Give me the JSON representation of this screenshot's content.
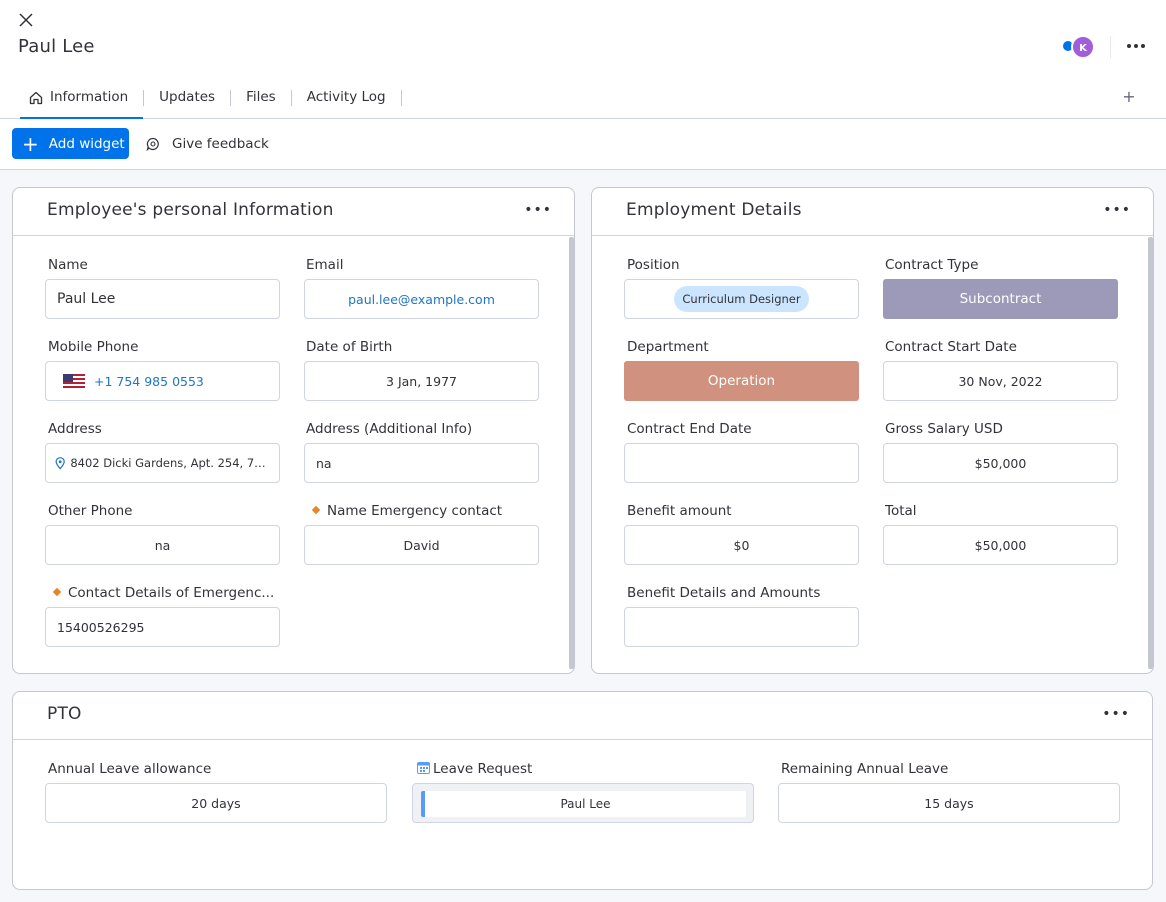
{
  "header": {
    "title": "Paul Lee",
    "avatar_initial": "K",
    "tabs": [
      "Information",
      "Updates",
      "Files",
      "Activity Log"
    ],
    "tab_add": "+"
  },
  "toolbar": {
    "add_widget": "Add widget",
    "feedback": "Give feedback"
  },
  "personal": {
    "title": "Employee's personal Information",
    "name_label": "Name",
    "name_value": "Paul Lee",
    "email_label": "Email",
    "email_value": "paul.lee@example.com",
    "mobile_label": "Mobile Phone",
    "mobile_value": "+1 754 985 0553",
    "dob_label": "Date of Birth",
    "dob_value": "3 Jan, 1977",
    "address_label": "Address",
    "address_value": "8402 Dicki Gardens, Apt. 254, 753...",
    "address_extra_label": "Address (Additional Info)",
    "address_extra_value": "na",
    "other_phone_label": "Other Phone",
    "other_phone_value": "na",
    "emergency_name_label": "Name Emergency contact",
    "emergency_name_value": "David",
    "emergency_contact_label": "Contact Details of Emergenc...",
    "emergency_contact_value": "15400526295"
  },
  "employment": {
    "title": "Employment Details",
    "position_label": "Position",
    "position_value": "Curriculum Designer",
    "contract_type_label": "Contract Type",
    "contract_type_value": "Subcontract",
    "department_label": "Department",
    "department_value": "Operation",
    "start_label": "Contract Start Date",
    "start_value": "30 Nov, 2022",
    "end_label": "Contract End Date",
    "end_value": "",
    "salary_label": "Gross Salary USD",
    "salary_value": "$50,000",
    "benefit_label": "Benefit amount",
    "benefit_value": "$0",
    "total_label": "Total",
    "total_value": "$50,000",
    "benefit_details_label": "Benefit Details and Amounts",
    "benefit_details_value": ""
  },
  "pto": {
    "title": "PTO",
    "allowance_label": "Annual Leave allowance",
    "allowance_value": "20 days",
    "request_label": "Leave Request",
    "request_value": "Paul Lee",
    "remaining_label": "Remaining Annual Leave",
    "remaining_value": "15 days"
  },
  "colors": {
    "primary": "#0073ea",
    "subcontract": "#9d99b9",
    "operation": "#d0917f",
    "chip": "#cce5ff",
    "avatar": "#a25ddc"
  },
  "icons": [
    "close-icon",
    "home-icon",
    "plus-icon",
    "feedback-icon",
    "more-icon",
    "flag-us-icon",
    "location-pin-icon",
    "calendar-icon"
  ]
}
